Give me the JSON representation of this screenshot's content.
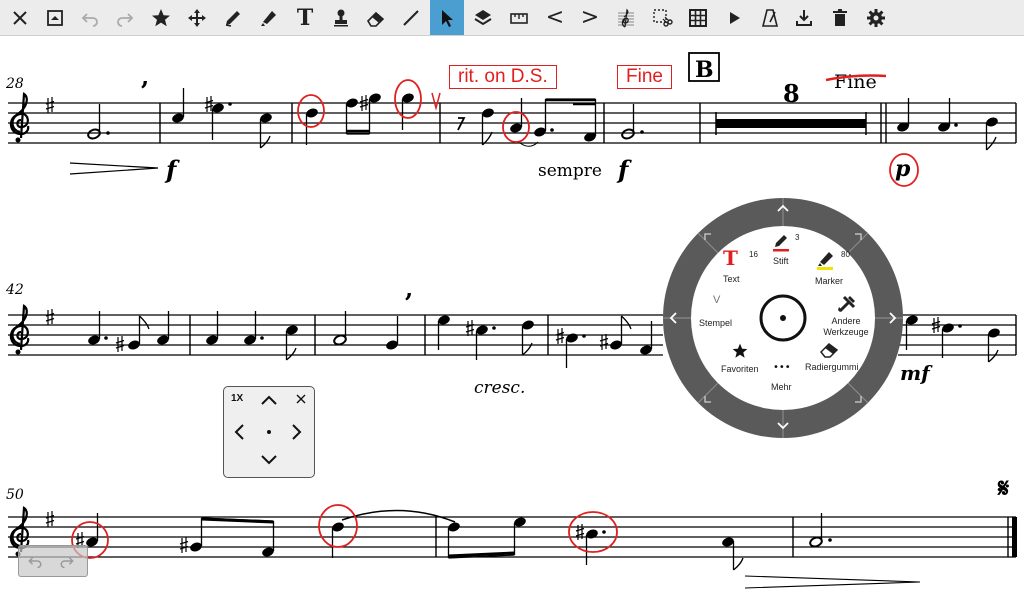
{
  "toolbar": {
    "active_tool": "select",
    "icons": [
      "close-icon",
      "fullscreen-icon",
      "undo-icon",
      "redo-icon",
      "star-icon",
      "move-icon",
      "pencil-icon",
      "marker-icon",
      "text-icon",
      "stamp-icon",
      "eraser-icon",
      "line-icon",
      "select-icon",
      "layers-icon",
      "ruler-icon",
      "less-than-icon",
      "greater-than-icon",
      "clef-icon",
      "cut-selection-icon",
      "grid-icon",
      "play-icon",
      "metronome-icon",
      "download-icon",
      "delete-icon",
      "settings-icon"
    ],
    "text_tool_label": "T",
    "less_than_label": "<",
    "greater_than_label": ">"
  },
  "score": {
    "measure_numbers": [
      "28",
      "42",
      "50"
    ],
    "annotations": {
      "rit": "rit. on D.S.",
      "fine_box": "Fine",
      "fine_struck": "Fine",
      "rehearsal": "B",
      "multirest": "8"
    },
    "dynamics": {
      "f1": "f",
      "f2": "f",
      "p": "p",
      "mf": "mf"
    },
    "expressions": {
      "sempre": "sempre",
      "cresc": "cresc."
    },
    "segno": "𝄋",
    "breath_mark": "’"
  },
  "wheel": {
    "text_label": "Text",
    "text_glyph": "T",
    "text_size": "16",
    "pen_label": "Stift",
    "pen_size": "3",
    "marker_label": "Marker",
    "marker_size": "80",
    "stamp_label": "Stempel",
    "stamp_glyph": "V",
    "other_tools_label": "Andere Werkzeuge",
    "favorites_label": "Favoriten",
    "more_label": "Mehr",
    "more_glyph": "•••",
    "eraser_label": "Radiergummi"
  },
  "navpad": {
    "zoom_label": "1X"
  },
  "colors": {
    "accent_blue": "#4a9fd0",
    "annotation_red": "#e02020",
    "wheel_ring": "#5a5a5a"
  }
}
